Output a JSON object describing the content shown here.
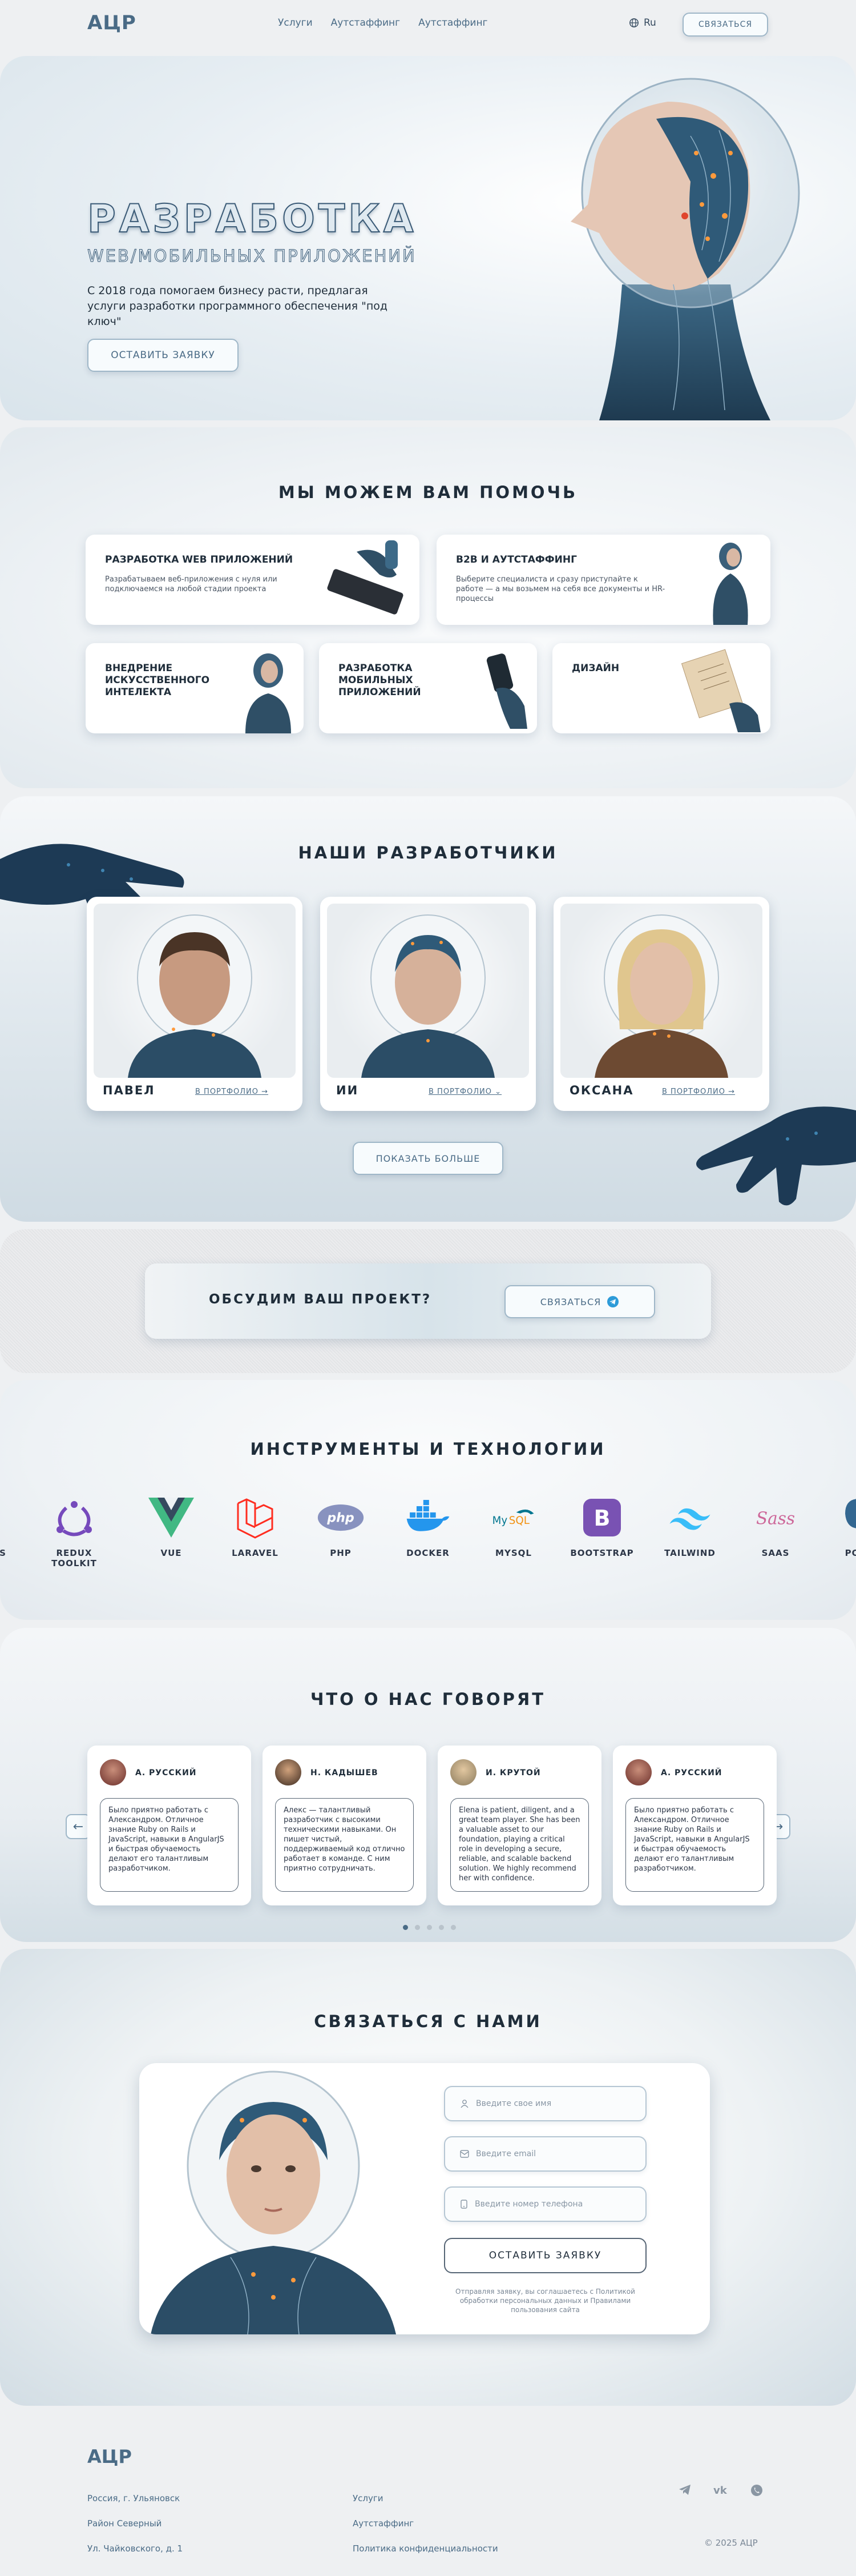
{
  "header": {
    "logo": "АЦР",
    "menu": [
      "Услуги",
      "Аутстаффинг",
      "Аутстаффинг"
    ],
    "lang": "Ru",
    "contact_btn": "СВЯЗАТЬСЯ"
  },
  "hero": {
    "title": "РАЗРАБОТКА",
    "subtitle": "WEB/МОБИЛЬНЫХ ПРИЛОЖЕНИЙ",
    "desc": "С 2018 года помогаем бизнесу расти, предлагая услуги разработки программного обеспечения \"под ключ\"",
    "btn": "ОСТАВИТЬ ЗАЯВКУ"
  },
  "help": {
    "title": "МЫ МОЖЕМ ВАМ ПОМОЧЬ",
    "cards": [
      {
        "title": "РАЗРАБОТКА WEB ПРИЛОЖЕНИЙ",
        "desc": "Разрабатываем веб-приложения с нуля или подключаемся на любой стадии проекта"
      },
      {
        "title": "B2B И АУТСТАФФИНГ",
        "desc": "Выберите специалиста и сразу приступайте к работе — а мы возьмем на себя все документы и HR-процессы"
      },
      {
        "title": "ВНЕДРЕНИЕ ИСКУССТВЕННОГО ИНТЕЛЕКТА",
        "desc": ""
      },
      {
        "title": "РАЗРАБОТКА МОБИЛЬНЫХ ПРИЛОЖЕНИЙ",
        "desc": ""
      },
      {
        "title": "ДИЗАЙН",
        "desc": ""
      }
    ]
  },
  "devs": {
    "title": "НАШИ РАЗРАБОТЧИКИ",
    "items": [
      {
        "name": "ПАВЕЛ",
        "link": "В ПОРТФОЛИО"
      },
      {
        "name": "ИИ",
        "link": "В ПОРТФОЛИО"
      },
      {
        "name": "ОКСАНА",
        "link": "В ПОРТФОЛИО"
      }
    ],
    "more_btn": "ПОКАЗАТЬ БОЛЬШЕ"
  },
  "cta": {
    "text": "ОБСУДИМ ВАШ ПРОЕКТ?",
    "btn": "СВЯЗАТЬСЯ"
  },
  "tools": {
    "title": "ИНСТРУМЕНТЫ И ТЕХНОЛОГИИ",
    "items": [
      "S",
      "REDUX TOOLKIT",
      "VUE",
      "LARAVEL",
      "PHP",
      "DOCKER",
      "MYSQL",
      "BOOTSTRAP",
      "TAILWIND",
      "SAAS",
      "POST"
    ]
  },
  "reviews": {
    "title": "ЧТО О НАС ГОВОРЯТ",
    "items": [
      {
        "name": "А. РУССКИЙ",
        "text": "Было приятно работать с Александром. Отличное знание Ruby on Rails и JavaScript, навыки в AngularJS и быстрая обучаемость делают его талантливым разработчиком."
      },
      {
        "name": "Н. КАДЫШЕВ",
        "text": "Алекс — талантливый разработчик с высокими техническими навыками. Он пишет чистый, поддерживаемый код отлично работает в команде. С ним приятно сотрудничать."
      },
      {
        "name": "И. КРУТОЙ",
        "text": "Elena is patient, diligent, and a great team player. She has been a valuable asset to our foundation, playing a critical role in developing a secure, reliable, and scalable backend solution. We highly recommend her with confidence."
      },
      {
        "name": "А. РУССКИЙ",
        "text": "Было приятно работать с Александром. Отличное знание Ruby on Rails и JavaScript, навыки в AngularJS и быстрая обучаемость делают его талантливым разработчиком."
      }
    ]
  },
  "contact": {
    "title": "СВЯЗАТЬСЯ С НАМИ",
    "name_ph": "Введите свое имя",
    "email_ph": "Введите email",
    "phone_ph": "Введите номер телефона",
    "btn": "ОСТАВИТЬ ЗАЯВКУ",
    "note": "Отправляя заявку, вы соглашаетесь с Политикой обработки персональных данных и Правилами пользования сайта"
  },
  "footer": {
    "logo": "АЦР",
    "addr": [
      "Россия, г. Ульяновск",
      "Район Северный",
      "Ул. Чайковского, д. 1"
    ],
    "links": [
      "Услуги",
      "Аутстаффинг",
      "Политика конфиденциальности"
    ],
    "copyright": "© 2025 АЦР"
  }
}
